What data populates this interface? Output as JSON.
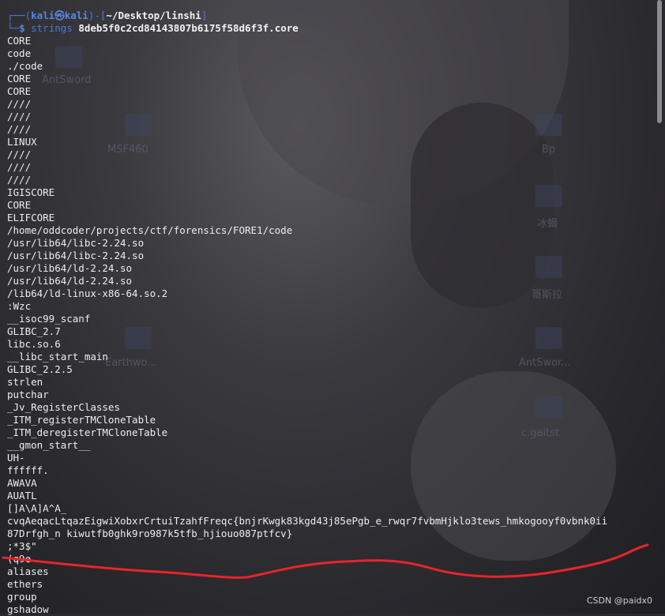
{
  "prompt": {
    "user": "kali",
    "host": "kali",
    "path": "~/Desktop/linshi",
    "command": "strings",
    "argument": "8deb5f0c2cd84143807b6175f58d6f3f.core"
  },
  "output": [
    "CORE",
    "code",
    "./code",
    "CORE",
    "CORE",
    "////",
    "////",
    "////",
    "LINUX",
    "////",
    "////",
    "////",
    "IGISCORE",
    "CORE",
    "ELIFCORE",
    "/home/oddcoder/projects/ctf/forensics/FORE1/code",
    "/usr/lib64/libc-2.24.so",
    "/usr/lib64/libc-2.24.so",
    "/usr/lib64/ld-2.24.so",
    "/usr/lib64/ld-2.24.so",
    "/lib64/ld-linux-x86-64.so.2",
    ":Wzc",
    "__isoc99_scanf",
    "GLIBC_2.7",
    "libc.so.6",
    "__libc_start_main",
    "GLIBC_2.2.5",
    "strlen",
    "putchar",
    "_Jv_RegisterClasses",
    "_ITM_registerTMCloneTable",
    "_ITM_deregisterTMCloneTable",
    "__gmon_start__",
    "UH-",
    "ffffff.",
    "AWAVA",
    "AUATL",
    "[]A\\A]A^A_",
    "cvqAeqacLtqazEigwiXobxrCrtuiTzahfFreqc{bnjrKwgk83kgd43j85ePgb_e_rwqr7fvbmHjklo3tews_hmkogooyf0vbnk0ii",
    "87Drfgh_n kiwutfb0ghk9ro987k5tfb_hjiouo087ptfcv}",
    ";*3$\"",
    "(q9e",
    "aliases",
    "ethers",
    "group",
    "gshadow"
  ],
  "desktop_icons": [
    "AntSword",
    "MSF460",
    "Bp",
    "冰蝎",
    "哥斯拉",
    "Earthwo...",
    "AntSwor...",
    "c.gaitst"
  ],
  "watermark": "CSDN @paidx0",
  "colors": {
    "prompt_frame": "#4b7ad4",
    "prompt_user": "#5a86e0",
    "text": "#ededee",
    "annotation": "#e8242a"
  }
}
